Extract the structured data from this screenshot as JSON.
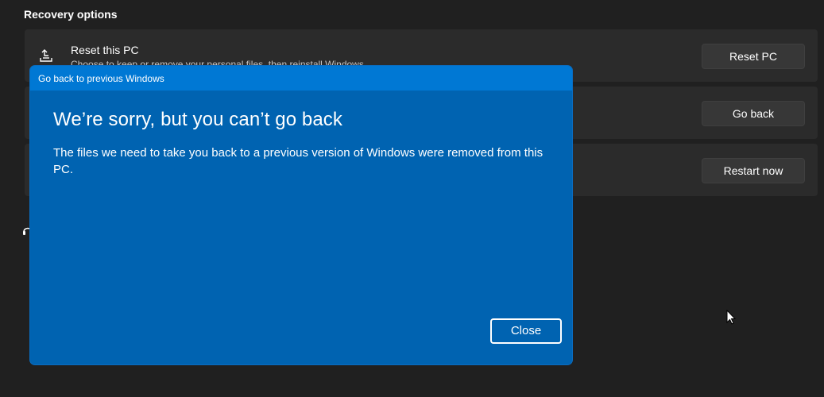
{
  "settings": {
    "section_title": "Recovery options",
    "cards": [
      {
        "title": "Reset this PC",
        "subtitle": "Choose to keep or remove your personal files, then reinstall Windows",
        "icon": "reset-pc-icon",
        "button_label": "Reset PC"
      },
      {
        "title": "",
        "subtitle": "",
        "icon": "",
        "button_label": "Go back"
      },
      {
        "title": "",
        "subtitle": "",
        "icon": "",
        "button_label": "Restart now"
      }
    ],
    "help_icon": "headset-icon"
  },
  "dialog": {
    "window_title": "Go back to previous Windows",
    "heading": "We’re sorry, but you can’t go back",
    "body": "The files we need to take you back to a previous version of Windows were removed from this PC.",
    "close_label": "Close"
  },
  "colors": {
    "background": "#202020",
    "card": "#2b2b2b",
    "dialog_body": "#0063b1",
    "dialog_titlebar": "#0078d4"
  }
}
